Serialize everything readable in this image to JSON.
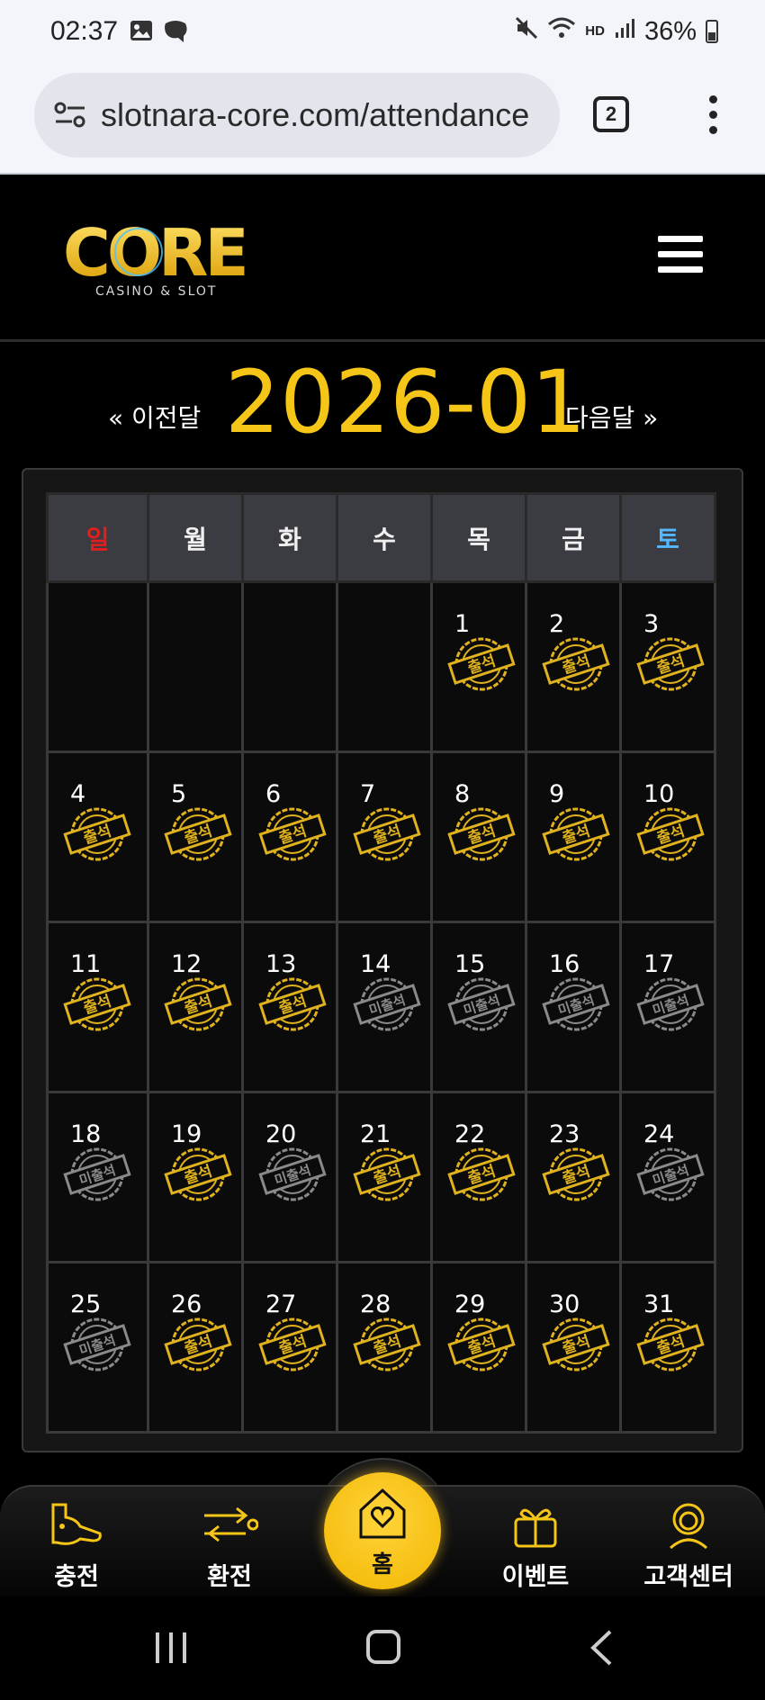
{
  "status_bar": {
    "time": "02:37",
    "battery": "36%",
    "left_icons": [
      "image-icon",
      "chat-bubble-icon"
    ],
    "right_icons": [
      "mute-icon",
      "wifi-icon",
      "hd-voice-icon",
      "signal-icon",
      "battery-icon"
    ],
    "hd_label": "HD"
  },
  "browser": {
    "url": "slotnara-core.com/attendance",
    "tab_count": "2"
  },
  "site": {
    "logo_text": "CORE",
    "logo_sub": "CASINO & SLOT"
  },
  "calendar": {
    "prev_label": "« 이전달",
    "next_label": "다음달 »",
    "month": "2026-01",
    "weekdays": [
      "일",
      "월",
      "화",
      "수",
      "목",
      "금",
      "토"
    ],
    "attended_label": "출석",
    "missed_label": "미출석",
    "weeks": [
      [
        null,
        null,
        null,
        null,
        {
          "day": "1",
          "status": "attended"
        },
        {
          "day": "2",
          "status": "attended"
        },
        {
          "day": "3",
          "status": "attended"
        }
      ],
      [
        {
          "day": "4",
          "status": "attended"
        },
        {
          "day": "5",
          "status": "attended"
        },
        {
          "day": "6",
          "status": "attended"
        },
        {
          "day": "7",
          "status": "attended"
        },
        {
          "day": "8",
          "status": "attended"
        },
        {
          "day": "9",
          "status": "attended"
        },
        {
          "day": "10",
          "status": "attended"
        }
      ],
      [
        {
          "day": "11",
          "status": "attended"
        },
        {
          "day": "12",
          "status": "attended"
        },
        {
          "day": "13",
          "status": "attended"
        },
        {
          "day": "14",
          "status": "missed"
        },
        {
          "day": "15",
          "status": "missed"
        },
        {
          "day": "16",
          "status": "missed"
        },
        {
          "day": "17",
          "status": "missed"
        }
      ],
      [
        {
          "day": "18",
          "status": "missed"
        },
        {
          "day": "19",
          "status": "attended"
        },
        {
          "day": "20",
          "status": "missed"
        },
        {
          "day": "21",
          "status": "attended"
        },
        {
          "day": "22",
          "status": "attended"
        },
        {
          "day": "23",
          "status": "attended"
        },
        {
          "day": "24",
          "status": "missed"
        }
      ],
      [
        {
          "day": "25",
          "status": "missed"
        },
        {
          "day": "26",
          "status": "attended"
        },
        {
          "day": "27",
          "status": "attended"
        },
        {
          "day": "28",
          "status": "attended"
        },
        {
          "day": "29",
          "status": "attended"
        },
        {
          "day": "30",
          "status": "attended"
        },
        {
          "day": "31",
          "status": "attended"
        }
      ]
    ],
    "colors": {
      "attended": "#e0b21e",
      "missed": "#8a8a8a",
      "sunday": "#e01e1e",
      "saturday": "#55b8ff"
    }
  },
  "bottom_nav": {
    "deposit": "충전",
    "exchange": "환전",
    "home": "홈",
    "event": "이벤트",
    "support": "고객센터"
  },
  "accent_color": "#f5c518"
}
